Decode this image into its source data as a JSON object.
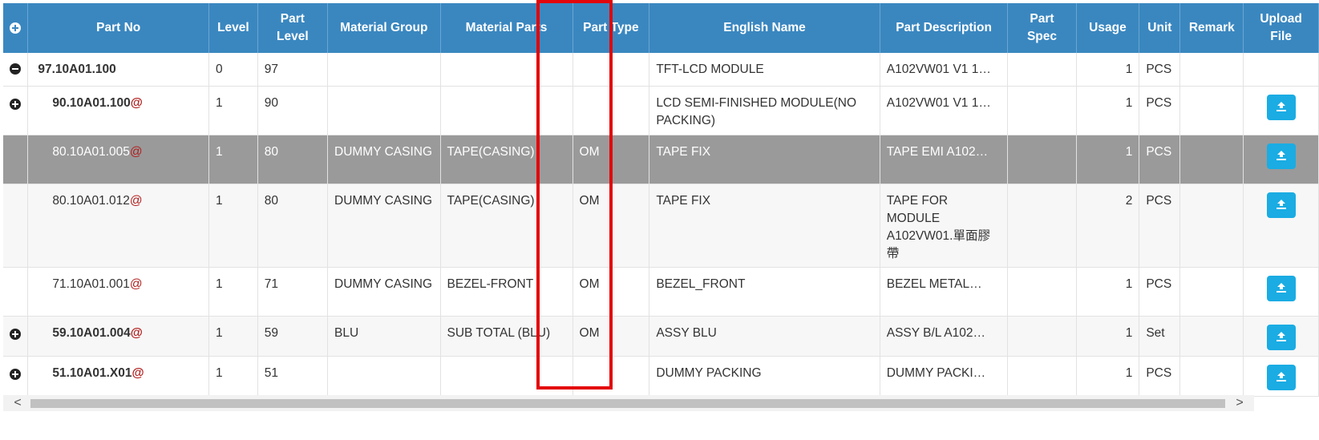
{
  "headers": {
    "add": "",
    "part_no": "Part No",
    "level": "Level",
    "part_level_1": "Part",
    "part_level_2": "Level",
    "material_group": "Material Group",
    "material_parts": "Material Parts",
    "part_type": "Part Type",
    "english_name": "English Name",
    "part_description": "Part Description",
    "part_spec_1": "Part",
    "part_spec_2": "Spec",
    "usage": "Usage",
    "unit": "Unit",
    "remark": "Remark",
    "upload_1": "Upload",
    "upload_2": "File"
  },
  "rows": [
    {
      "toggle": "minus",
      "part_no": "97.10A01.100",
      "at": "",
      "level": "0",
      "part_level": "97",
      "material_group": "",
      "material_parts": "",
      "part_type": "",
      "english_name": "TFT-LCD MODULE",
      "part_description": "A102VW01 V1 1…",
      "part_spec": "",
      "usage": "1",
      "unit": "PCS",
      "remark": "",
      "upload": false
    },
    {
      "toggle": "plus",
      "part_no": "90.10A01.100",
      "at": "@",
      "level": "1",
      "part_level": "90",
      "material_group": "",
      "material_parts": "",
      "part_type": "",
      "english_name": "LCD SEMI-FINISHED MODULE(NO PACKING)",
      "part_description": "A102VW01 V1 1…",
      "part_spec": "",
      "usage": "1",
      "unit": "PCS",
      "remark": "",
      "upload": true
    },
    {
      "toggle": "",
      "part_no": "80.10A01.005",
      "at": "@",
      "level": "1",
      "part_level": "80",
      "material_group": "DUMMY CASING",
      "material_parts": "TAPE(CASING)",
      "part_type": "OM",
      "english_name": "TAPE FIX",
      "part_description": "TAPE EMI A102…",
      "part_spec": "",
      "usage": "1",
      "unit": "PCS",
      "remark": "",
      "upload": true
    },
    {
      "toggle": "",
      "part_no": "80.10A01.012",
      "at": "@",
      "level": "1",
      "part_level": "80",
      "material_group": "DUMMY CASING",
      "material_parts": "TAPE(CASING)",
      "part_type": "OM",
      "english_name": "TAPE FIX",
      "part_description": "TAPE FOR MODULE A102VW01.單面膠帶",
      "part_spec": "",
      "usage": "2",
      "unit": "PCS",
      "remark": "",
      "upload": true
    },
    {
      "toggle": "",
      "part_no": "71.10A01.001",
      "at": "@",
      "level": "1",
      "part_level": "71",
      "material_group": "DUMMY CASING",
      "material_parts": "BEZEL-FRONT",
      "part_type": "OM",
      "english_name": "BEZEL_FRONT",
      "part_description": "BEZEL METAL…",
      "part_spec": "",
      "usage": "1",
      "unit": "PCS",
      "remark": "",
      "upload": true
    },
    {
      "toggle": "plus",
      "part_no": "59.10A01.004",
      "at": "@",
      "level": "1",
      "part_level": "59",
      "material_group": "BLU",
      "material_parts": "SUB TOTAL (BLU)",
      "part_type": "OM",
      "english_name": "ASSY BLU",
      "part_description": "ASSY B/L A102…",
      "part_spec": "",
      "usage": "1",
      "unit": "Set",
      "remark": "",
      "upload": true
    },
    {
      "toggle": "plus",
      "part_no": "51.10A01.X01",
      "at": "@",
      "level": "1",
      "part_level": "51",
      "material_group": "",
      "material_parts": "",
      "part_type": "",
      "english_name": "DUMMY PACKING",
      "part_description": "DUMMY PACKI…",
      "part_spec": "",
      "usage": "1",
      "unit": "PCS",
      "remark": "",
      "upload": true
    }
  ],
  "scroll": {
    "left": "<",
    "right": ">"
  },
  "icons": {
    "add": "plus-circle-icon",
    "collapse": "minus-circle-icon",
    "expand": "plus-circle-icon",
    "upload": "upload-icon"
  },
  "colors": {
    "header": "#3a87c0",
    "selected_row": "#9a9a9a",
    "upload_button": "#1aace3",
    "highlight": "#e3060b",
    "part_no_at": "#b21f1f"
  }
}
